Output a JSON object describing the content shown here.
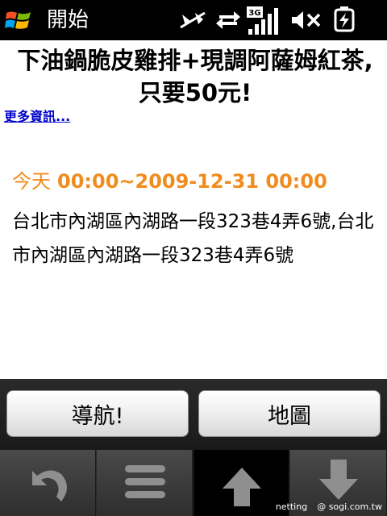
{
  "status_bar": {
    "start_label": "開始",
    "network_label": "3G",
    "icons": [
      "windows-logo",
      "signal-off-icon",
      "data-transfer-icon",
      "signal-strength-icon",
      "volume-mute-icon",
      "battery-charging-icon"
    ]
  },
  "content": {
    "headline_prefix": "下油鍋脆皮雞排+現調阿薩姆紅茶,只要",
    "headline_price": "50元!",
    "more_link": "更多資訊...",
    "time_day": "今天",
    "time_range": "00:00~2009-12-31 00:00",
    "address": "台北市內湖區內湖路一段323巷4弄6號,台北市內湖區內湖路一段323巷4弄6號",
    "accent_color": "#f08c1e"
  },
  "actions": {
    "navigate_label": "導航!",
    "map_label": "地圖"
  },
  "softkeys": {
    "icons": [
      "back-icon",
      "menu-icon",
      "arrow-up-icon",
      "arrow-down-icon"
    ]
  },
  "watermark": {
    "left": "netting",
    "right": "@ sogi.com.tw"
  }
}
